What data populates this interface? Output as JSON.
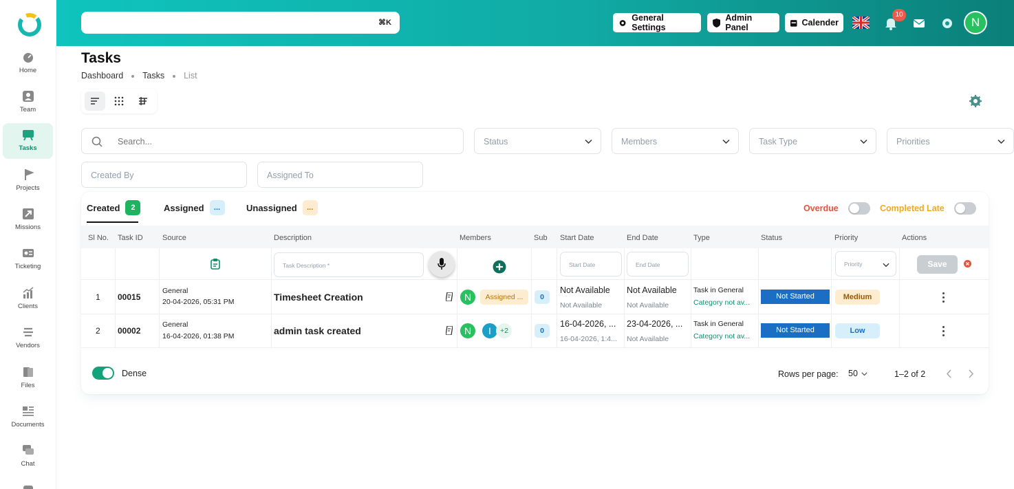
{
  "search": {
    "shortcut": "⌘K"
  },
  "header": {
    "general_settings": "General Settings",
    "admin_panel": "Admin Panel",
    "calender": "Calender",
    "notifications_count": "10",
    "avatar_initial": "N"
  },
  "sidebar": {
    "items": [
      {
        "label": "Home",
        "icon": "home-icon"
      },
      {
        "label": "Team",
        "icon": "team-icon"
      },
      {
        "label": "Tasks",
        "icon": "tasks-icon"
      },
      {
        "label": "Projects",
        "icon": "projects-icon"
      },
      {
        "label": "Missions",
        "icon": "missions-icon"
      },
      {
        "label": "Ticketing",
        "icon": "ticketing-icon"
      },
      {
        "label": "Clients",
        "icon": "clients-icon"
      },
      {
        "label": "Vendors",
        "icon": "vendors-icon"
      },
      {
        "label": "Files",
        "icon": "files-icon"
      },
      {
        "label": "Documents",
        "icon": "documents-icon"
      },
      {
        "label": "Chat",
        "icon": "chat-icon"
      }
    ]
  },
  "page": {
    "title": "Tasks",
    "breadcrumb": [
      "Dashboard",
      "Tasks",
      "List"
    ]
  },
  "filters": {
    "search_placeholder": "Search...",
    "status": "Status",
    "members": "Members",
    "task_type": "Task Type",
    "priorities": "Priorities",
    "created_by": "Created By",
    "assigned_to": "Assigned To"
  },
  "tabs": [
    {
      "label": "Created",
      "count": "2"
    },
    {
      "label": "Assigned",
      "count": "..."
    },
    {
      "label": "Unassigned",
      "count": "..."
    }
  ],
  "toggles": {
    "overdue": "Overdue",
    "completed_late": "Completed Late"
  },
  "table": {
    "headers": [
      "Sl No.",
      "Task ID",
      "Source",
      "Description",
      "Members",
      "Sub",
      "Start Date",
      "End Date",
      "Type",
      "Status",
      "Priority",
      "Actions"
    ],
    "new_row": {
      "description_placeholder": "Task Description *",
      "start_placeholder": "Start Date",
      "end_placeholder": "End Date",
      "priority_placeholder": "Priority",
      "save": "Save"
    },
    "rows": [
      {
        "sl": "1",
        "task_id": "00015",
        "source": "General",
        "source_date": "20-04-2026, 05:31 PM",
        "description": "Timesheet Creation",
        "member_initial": "N",
        "member_status": "Assigned ...",
        "sub": "0",
        "start_main": "Not Available",
        "start_sub": "Not Available",
        "end_main": "Not Available",
        "end_sub": "Not Available",
        "type_main": "Task in General",
        "type_sub": "Category not av...",
        "status": "Not Started",
        "priority": "Medium"
      },
      {
        "sl": "2",
        "task_id": "00002",
        "source": "General",
        "source_date": "16-04-2026, 01:38 PM",
        "description": "admin task created",
        "member_initial": "N",
        "member_initial_2": "I",
        "member_extra": "+2",
        "sub": "0",
        "start_main": "16-04-2026, ...",
        "start_sub": "16-04-2026, 1:4...",
        "end_main": "23-04-2026, ...",
        "end_sub": "Not Available",
        "type_main": "Task in General",
        "type_sub": "Category not av...",
        "status": "Not Started",
        "priority": "Low"
      }
    ]
  },
  "footer": {
    "dense": "Dense",
    "rows_per_page_label": "Rows per page:",
    "rows_per_page": "50",
    "range": "1–2 of 2"
  },
  "colors": {
    "accent": "#0e8f6c",
    "header_gradient_start": "#0fc4be",
    "header_gradient_end": "#0b7f79",
    "status_blue": "#1a6fc4",
    "overdue": "#e5533d",
    "completed_late": "#f5a623"
  }
}
